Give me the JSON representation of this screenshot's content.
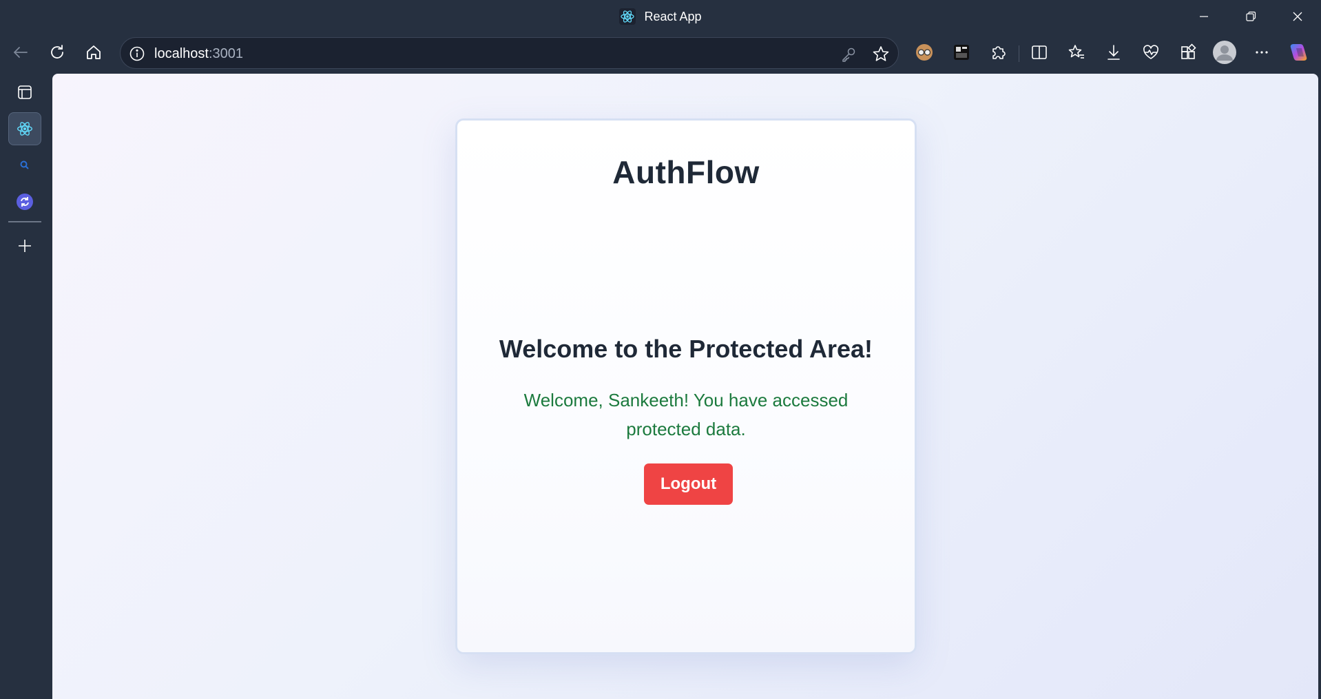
{
  "window": {
    "title": "React App"
  },
  "toolbar": {
    "url_host": "localhost",
    "url_port": ":3001"
  },
  "page": {
    "brand": "AuthFlow",
    "heading": "Welcome to the Protected Area!",
    "message": "Welcome, Sankeeth! You have accessed protected data.",
    "logout_label": "Logout"
  },
  "colors": {
    "chrome_bg": "#263040",
    "logout_button": "#ef4444",
    "message_text": "#1c7a3e",
    "heading_text": "#1f2937"
  },
  "icons": {
    "favicon": "react-icon",
    "back": "arrow-left-icon",
    "refresh": "refresh-icon",
    "home": "home-icon",
    "info": "info-icon",
    "key": "key-icon",
    "favorite": "star-icon",
    "avatar": "avatar"
  }
}
